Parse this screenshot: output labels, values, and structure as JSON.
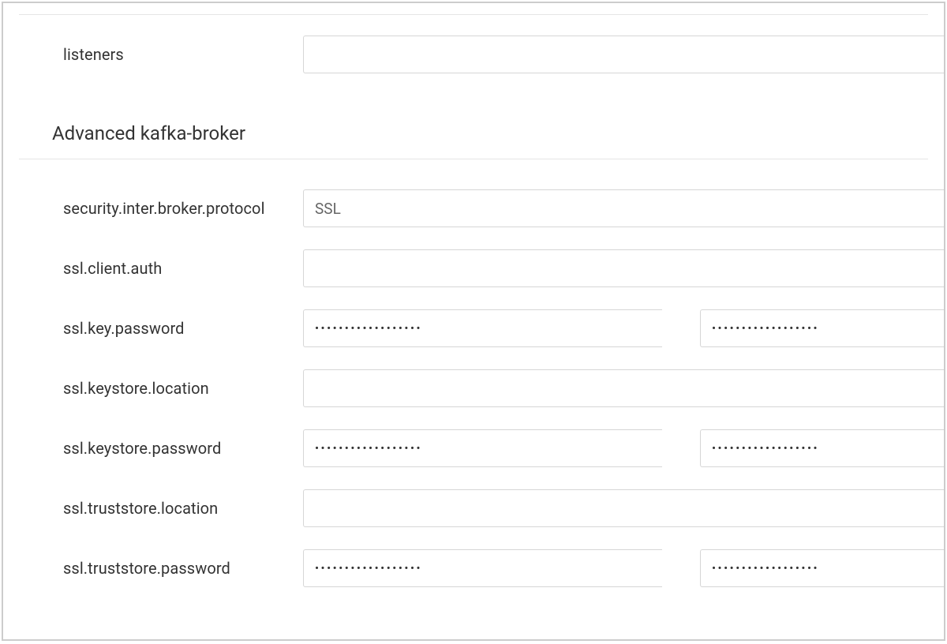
{
  "top_section": {
    "listeners": {
      "label": "listeners",
      "value": ""
    }
  },
  "advanced_section": {
    "title": "Advanced kafka-broker",
    "fields": {
      "security_inter_broker_protocol": {
        "label": "security.inter.broker.protocol",
        "value": "SSL"
      },
      "ssl_client_auth": {
        "label": "ssl.client.auth",
        "value": ""
      },
      "ssl_key_password": {
        "label": "ssl.key.password",
        "value1": "••••••••••••••••••",
        "value2": "••••••••••••••••••"
      },
      "ssl_keystore_location": {
        "label": "ssl.keystore.location",
        "value": ""
      },
      "ssl_keystore_password": {
        "label": "ssl.keystore.password",
        "value1": "••••••••••••••••••",
        "value2": "••••••••••••••••••"
      },
      "ssl_truststore_location": {
        "label": "ssl.truststore.location",
        "value": ""
      },
      "ssl_truststore_password": {
        "label": "ssl.truststore.password",
        "value1": "••••••••••••••••••",
        "value2": "••••••••••••••••••"
      }
    }
  }
}
